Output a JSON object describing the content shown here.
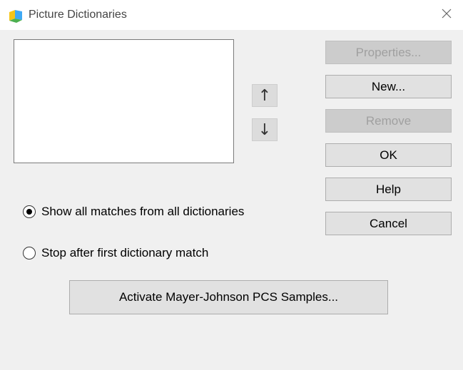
{
  "window": {
    "title": "Picture Dictionaries"
  },
  "listbox": {
    "items": []
  },
  "arrows": {
    "up_glyph": "↑",
    "down_glyph": "↓"
  },
  "buttons": {
    "properties": "Properties...",
    "new": "New...",
    "remove": "Remove",
    "ok": "OK",
    "help": "Help",
    "cancel": "Cancel",
    "activate": "Activate Mayer-Johnson PCS Samples..."
  },
  "options": {
    "show_all": {
      "label": "Show all matches from all dictionaries",
      "selected": true
    },
    "stop_first": {
      "label": "Stop after first dictionary match",
      "selected": false
    }
  },
  "icons": {
    "app": "picture-dictionary-icon",
    "close": "close-icon"
  },
  "colors": {
    "dialog_bg": "#f0f0f0",
    "button_bg": "#e1e1e1",
    "disabled_text": "#a0a0a0"
  }
}
